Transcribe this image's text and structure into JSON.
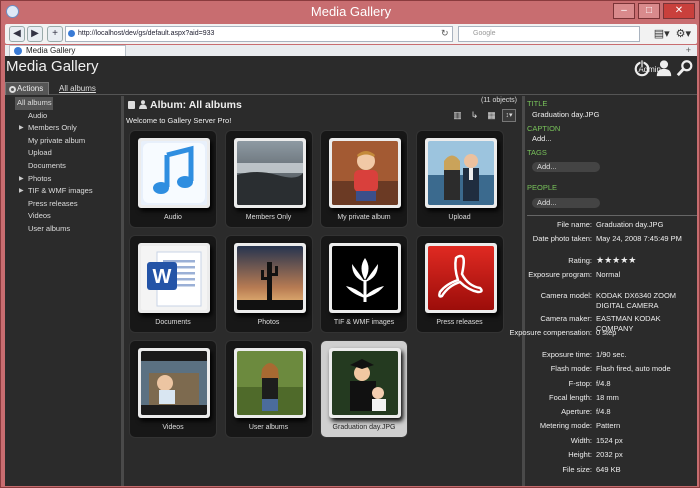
{
  "window": {
    "title": "Media Gallery"
  },
  "browser": {
    "address": "http://localhost/dev/gs/default.aspx?aid=933",
    "search_placeholder": "Google",
    "tab_label": "Media Gallery"
  },
  "header": {
    "app_title": "Media Gallery",
    "user": "Admin"
  },
  "menubar": {
    "actions_label": "Actions",
    "breadcrumb": "All albums"
  },
  "tree": [
    {
      "label": "All albums",
      "selected": true,
      "expandable": false
    },
    {
      "label": "Audio",
      "expandable": false
    },
    {
      "label": "Members Only",
      "expandable": true
    },
    {
      "label": "My private album",
      "expandable": false
    },
    {
      "label": "Upload",
      "expandable": false
    },
    {
      "label": "Documents",
      "expandable": false
    },
    {
      "label": "Photos",
      "expandable": true
    },
    {
      "label": "TIF & WMF images",
      "expandable": true
    },
    {
      "label": "Press releases",
      "expandable": false
    },
    {
      "label": "Videos",
      "expandable": false
    },
    {
      "label": "User albums",
      "expandable": false
    }
  ],
  "album": {
    "title": "Album: All albums",
    "object_count": "(11 objects)",
    "welcome": "Welcome to Gallery Server Pro!"
  },
  "items": [
    {
      "caption": "Audio",
      "thumb": "music-note"
    },
    {
      "caption": "Members Only",
      "thumb": "misty-landscape"
    },
    {
      "caption": "My private album",
      "thumb": "child-photo"
    },
    {
      "caption": "Upload",
      "thumb": "couple-photo"
    },
    {
      "caption": "Documents",
      "thumb": "word-document"
    },
    {
      "caption": "Photos",
      "thumb": "cactus-sunset"
    },
    {
      "caption": "TIF & WMF images",
      "thumb": "tulip-graphic"
    },
    {
      "caption": "Press releases",
      "thumb": "pdf-document"
    },
    {
      "caption": "Videos",
      "thumb": "baby-video"
    },
    {
      "caption": "User albums",
      "thumb": "woman-outdoors"
    },
    {
      "caption": "Graduation day.JPG",
      "thumb": "graduate-photo",
      "selected": true
    }
  ],
  "properties": {
    "title_label": "TITLE",
    "title_value": "Graduation day.JPG",
    "caption_label": "CAPTION",
    "caption_value": "Add...",
    "tags_label": "TAGS",
    "tags_value": "Add...",
    "people_label": "PEOPLE",
    "people_value": "Add..."
  },
  "metadata": [
    {
      "key": "File name:",
      "value": "Graduation day.JPG"
    },
    {
      "key": "Date photo taken:",
      "value": "May 24, 2008 7:45:49 PM"
    },
    {
      "key": "Rating:",
      "value": "★★★★★"
    },
    {
      "key": "Exposure program:",
      "value": "Normal"
    },
    {
      "key": "Camera model:",
      "value": "KODAK DX6340 ZOOM DIGITAL CAMERA"
    },
    {
      "key": "Camera maker:",
      "value": "EASTMAN KODAK COMPANY"
    },
    {
      "key": "Exposure compensation:",
      "value": "0 step"
    },
    {
      "key": "Exposure time:",
      "value": "1/90 sec."
    },
    {
      "key": "Flash mode:",
      "value": "Flash fired, auto mode"
    },
    {
      "key": "F-stop:",
      "value": "f/4.8"
    },
    {
      "key": "Focal length:",
      "value": "18 mm"
    },
    {
      "key": "Aperture:",
      "value": "f/4.8"
    },
    {
      "key": "Metering mode:",
      "value": "Pattern"
    },
    {
      "key": "Width:",
      "value": "1524 px"
    },
    {
      "key": "Height:",
      "value": "2032 px"
    },
    {
      "key": "File size:",
      "value": "649 KB"
    }
  ],
  "colors": {
    "accent_green": "#78c25a",
    "panel_bg": "#2b2b2b",
    "browser_frame": "#c86d70"
  }
}
